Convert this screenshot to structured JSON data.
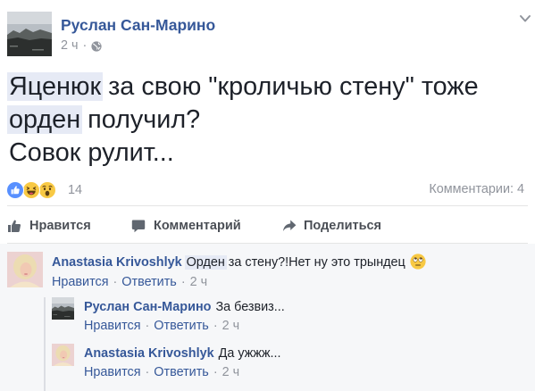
{
  "colors": {
    "link": "#365899",
    "text": "#1d2129",
    "meta": "#90949c",
    "action": "#4b4f56",
    "icon": "#606770",
    "highlight": "#e6eaf5",
    "divider": "#e5e5e5",
    "comments_bg": "#f6f7f9",
    "thread_line": "#dcdee3",
    "like_blue": "#5890ff",
    "reaction_yellow": "#f8c944"
  },
  "post": {
    "author": "Руслан Сан-Марино",
    "time": "2 ч",
    "separator": "·",
    "privacy_icon": "globe-icon",
    "menu_icon": "chevron-down-icon",
    "body": [
      {
        "segments": [
          {
            "text": "Яценюк",
            "highlight": true
          },
          {
            "text": " за свою \"кроличью стену\" тоже",
            "highlight": false
          }
        ]
      },
      {
        "segments": [
          {
            "text": "орден",
            "highlight": true
          },
          {
            "text": " получил?",
            "highlight": false
          }
        ]
      },
      {
        "segments": [
          {
            "text": "Совок рулит...",
            "highlight": false
          }
        ]
      }
    ]
  },
  "reactions": {
    "icons": [
      "like-reaction-icon",
      "haha-reaction-icon",
      "wow-reaction-icon"
    ],
    "count": 14,
    "comments_label": "Комментарии: 4"
  },
  "actions": [
    {
      "label": "Нравится",
      "icon": "thumbs-up-icon"
    },
    {
      "label": "Комментарий",
      "icon": "comment-bubble-icon"
    },
    {
      "label": "Поделиться",
      "icon": "share-arrow-icon"
    }
  ],
  "comments": [
    {
      "author": "Anastasia Krivoshlyk",
      "segments": [
        {
          "text": "Орден",
          "highlight": true
        },
        {
          "text": " за стену?!Нет ну это трындец",
          "highlight": false
        }
      ],
      "emoji_icon": "face-with-rolling-eyes-icon",
      "like_label": "Нравится",
      "reply_label": "Ответить",
      "time": "2 ч",
      "separator": "·",
      "replies": [
        {
          "author": "Руслан Сан-Марино",
          "text": "За безвиз...",
          "like_label": "Нравится",
          "reply_label": "Ответить",
          "time": "2 ч",
          "separator": "·"
        },
        {
          "author": "Anastasia Krivoshlyk",
          "text": "Да ужжж...",
          "like_label": "Нравится",
          "reply_label": "Ответить",
          "time": "2 ч",
          "separator": "·"
        }
      ]
    }
  ]
}
